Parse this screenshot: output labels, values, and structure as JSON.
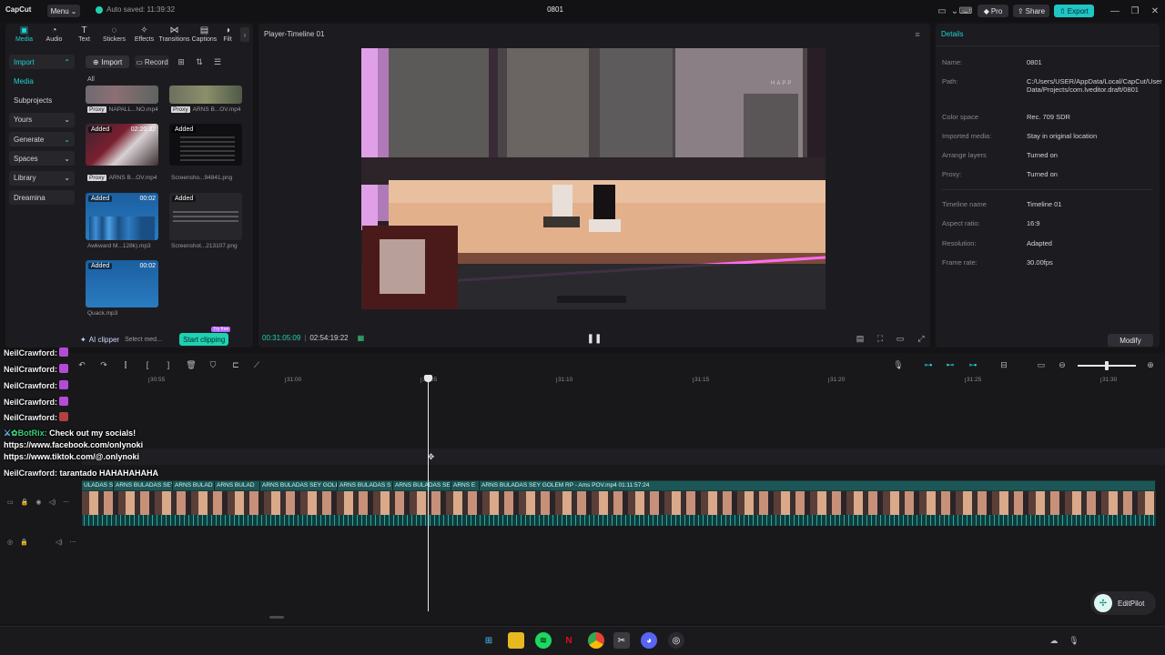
{
  "titlebar": {
    "logo": "CapCut",
    "menu_label": "Menu",
    "autosave": "Auto saved: 11:39:32",
    "project_title": "0801",
    "pro_label": "Pro",
    "share_label": "Share",
    "export_label": "Export"
  },
  "tool_tabs": [
    {
      "label": "Media",
      "icon": "media-icon"
    },
    {
      "label": "Audio",
      "icon": "audio-icon"
    },
    {
      "label": "Text",
      "icon": "text-icon"
    },
    {
      "label": "Stickers",
      "icon": "stickers-icon"
    },
    {
      "label": "Effects",
      "icon": "effects-icon"
    },
    {
      "label": "Transitions",
      "icon": "transitions-icon"
    },
    {
      "label": "Captions",
      "icon": "captions-icon"
    },
    {
      "label": "Filt",
      "icon": "filters-icon"
    }
  ],
  "side_nav": [
    {
      "label": "Import"
    },
    {
      "label": "Media"
    },
    {
      "label": "Subprojects"
    },
    {
      "label": "Yours"
    },
    {
      "label": "Generate"
    },
    {
      "label": "Spaces"
    },
    {
      "label": "Library"
    },
    {
      "label": "Dreamina"
    }
  ],
  "media_toolbar": {
    "import_label": "Import",
    "record_label": "Record",
    "all_label": "All"
  },
  "media_items": [
    {
      "name": "NAPALL...NO.mp4",
      "proxy": "Proxy",
      "added": "",
      "duration": ""
    },
    {
      "name": "ARNS B...OV.mp4",
      "proxy": "Proxy",
      "added": "",
      "duration": ""
    },
    {
      "name": "ARNS B...OV.mp4",
      "proxy": "Proxy",
      "added": "Added",
      "duration": "02:20:32"
    },
    {
      "name": "Screensho...94841.png",
      "proxy": "",
      "added": "Added",
      "duration": ""
    },
    {
      "name": "Awkward M...128k).mp3",
      "proxy": "",
      "added": "Added",
      "duration": "00:02"
    },
    {
      "name": "Screenshot...213107.png",
      "proxy": "",
      "added": "Added",
      "duration": ""
    },
    {
      "name": "Quack.mp3",
      "proxy": "",
      "added": "Added",
      "duration": "00:02"
    }
  ],
  "left_bottom": {
    "ai_clipper": "AI clipper",
    "select_media": "Select med...",
    "start_clipping": "Start clipping",
    "try_free": "Try free"
  },
  "player": {
    "title": "Player-Timeline 01",
    "current_time": "00:31:05:09",
    "total_time": "02:54:19:22"
  },
  "details": {
    "title": "Details",
    "rows": [
      {
        "label": "Name:",
        "value": "0801"
      },
      {
        "label": "Path:",
        "value": "C:/Users/USER/AppData/Local/CapCut/User Data/Projects/com.lveditor.draft/0801"
      },
      {
        "label": "Color space",
        "value": "Rec. 709 SDR"
      },
      {
        "label": "Imported media:",
        "value": "Stay in original location"
      },
      {
        "label": "Arrange layers",
        "value": "Turned on"
      },
      {
        "label": "Proxy:",
        "value": "Turned on"
      },
      {
        "label": "Timeline name",
        "value": "Timeline 01"
      },
      {
        "label": "Aspect ratio:",
        "value": "16:9"
      },
      {
        "label": "Resolution:",
        "value": "Adapted"
      },
      {
        "label": "Frame rate:",
        "value": "30.00fps"
      }
    ],
    "modify_label": "Modify"
  },
  "timeline": {
    "ticks": [
      "30:55",
      "31:00",
      "31:05",
      "31:10",
      "31:15",
      "31:20",
      "31:25",
      "31:30"
    ],
    "clips": [
      {
        "label": "ULADAS SE"
      },
      {
        "label": "ARNS BULADAS SEY"
      },
      {
        "label": "ARNS BULAD"
      },
      {
        "label": "ARNS BULAD"
      },
      {
        "label": "ARNS BULADAS SEY GOLE"
      },
      {
        "label": "ARNS BULADAS S"
      },
      {
        "label": "ARNS BULADAS SE"
      },
      {
        "label": "ARNS E"
      },
      {
        "label": "ARNS BULADAS SEY GOLEM RP - Ams POV.mp4   01:11:57:24"
      }
    ]
  },
  "chat": [
    {
      "user": "NeilCrawford:",
      "text": ""
    },
    {
      "user": "NeilCrawford:",
      "text": ""
    },
    {
      "user": "NeilCrawford:",
      "text": ""
    },
    {
      "user": "NeilCrawford:",
      "text": ""
    },
    {
      "user": "NeilCrawford:",
      "text": ""
    },
    {
      "user": "BotRix:",
      "text": "Check out my socials!"
    },
    {
      "user": "",
      "text": "https://www.facebook.com/onlynoki"
    },
    {
      "user": "",
      "text": "https://www.tiktok.com/@.onlynoki"
    },
    {
      "user": "NeilCrawford:",
      "text": "tarantado HAHAHAHAHA"
    }
  ],
  "video_overlay": {
    "hud_text": "HAPP"
  },
  "editpilot_label": "EditPilot",
  "colors": {
    "accent": "#1fd1d1",
    "export": "#1fc6c6",
    "clip_track": "#1d5656"
  }
}
